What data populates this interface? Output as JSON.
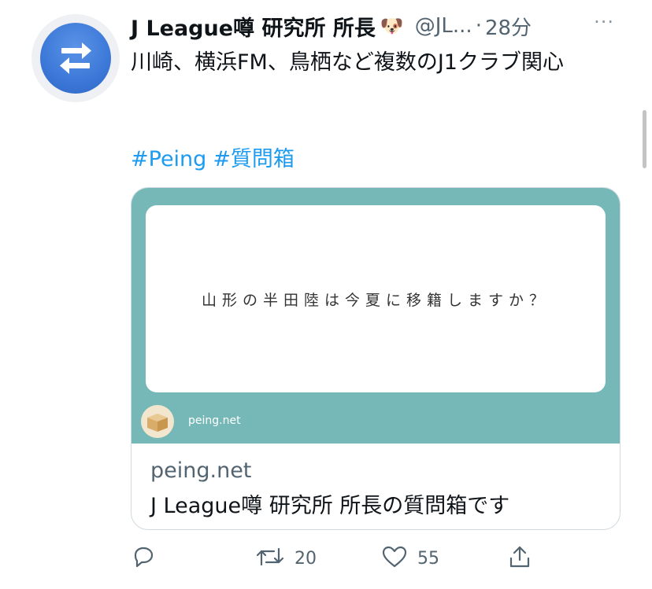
{
  "tweet": {
    "author_name": "J League噂 研究所 所長",
    "author_emoji": "🐶",
    "handle": "@JL...",
    "separator": "·",
    "time": "28分",
    "more_glyph": "···",
    "text": "川崎、横浜FM、鳥栖など複数のJ1クラブ関心",
    "hashtags": [
      "#Peing",
      "#質問箱"
    ]
  },
  "card": {
    "question": "山形の半田陸は今夏に移籍しますか？",
    "image_domain": "peing.net",
    "domain": "peing.net",
    "title": "J League噂 研究所 所長の質問箱です"
  },
  "actions": {
    "retweets": "20",
    "likes": "55"
  },
  "icons": {
    "avatar": "swap-arrows-icon",
    "reply": "reply-icon",
    "retweet": "retweet-icon",
    "like": "heart-icon",
    "share": "share-icon"
  },
  "colors": {
    "link": "#1d9bf0",
    "card_bg": "#76b8b7",
    "avatar_blue": "#3c78d8",
    "muted": "#536471"
  }
}
